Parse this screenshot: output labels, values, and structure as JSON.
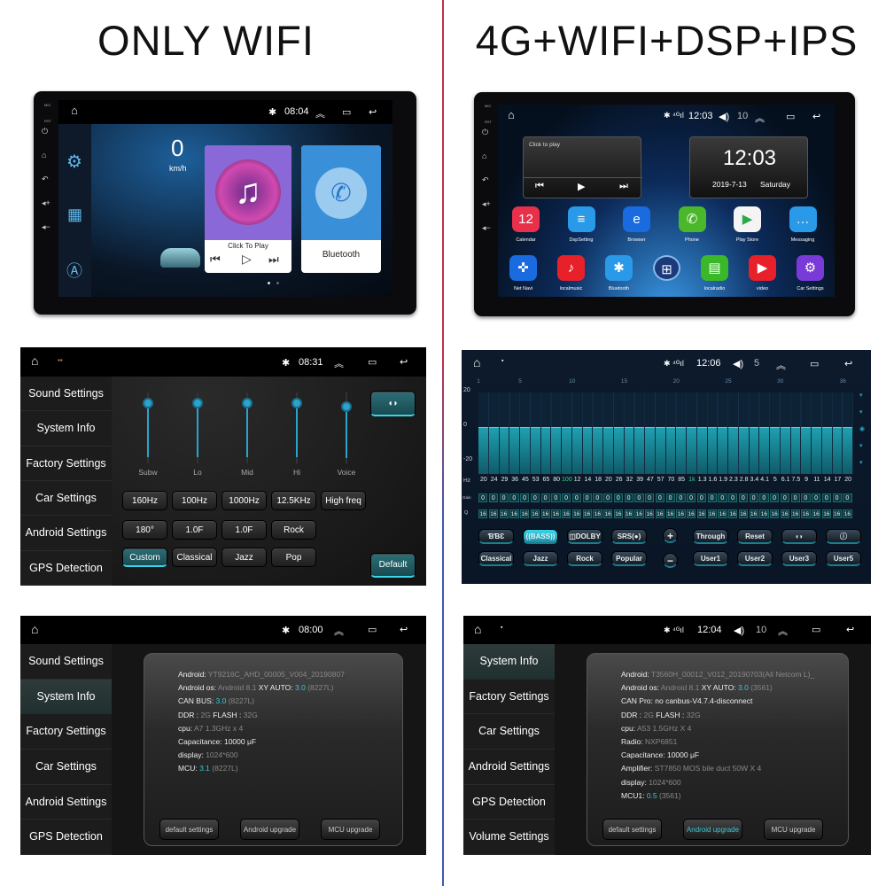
{
  "titles": {
    "left": "ONLY WIFI",
    "right": "4G+WIFI+DSP+IPS"
  },
  "colors": {
    "accent": "#36c9d8",
    "divider_top": "#c0304a",
    "divider_bottom": "#3a5bb0"
  },
  "device_side_labels": {
    "mic": "MIC",
    "rst": "RST"
  },
  "home_wifi": {
    "time": "08:04",
    "speed": "0",
    "speed_unit": "km/h",
    "music_label": "Click To Play",
    "bluetooth_label": "Bluetooth"
  },
  "home_4g": {
    "time": "12:03",
    "volume": "10",
    "player_label": "Click to play",
    "clock": "12:03",
    "date": "2019-7-13",
    "weekday": "Saturday",
    "apps_row1": [
      "Calendar",
      "DspSetting",
      "Browser",
      "Phone",
      "Play Store",
      "Messaging"
    ],
    "apps_row2": [
      "Net Navi",
      "localmusic",
      "Bluetooth",
      "",
      "localradio",
      "video",
      "Car Settings"
    ],
    "calendar_day": "12"
  },
  "sound_wifi": {
    "time": "08:31",
    "menu": [
      "Sound Settings",
      "System Info",
      "Factory Settings",
      "Car Settings",
      "Android Settings",
      "GPS Detection"
    ],
    "sliders": [
      {
        "label": "Subw",
        "level": 0.85
      },
      {
        "label": "Lo",
        "level": 0.85
      },
      {
        "label": "Mid",
        "level": 0.85
      },
      {
        "label": "Hi",
        "level": 0.85
      },
      {
        "label": "Voice",
        "level": 0.8
      }
    ],
    "freq_buttons": [
      "160Hz",
      "100Hz",
      "1000Hz",
      "12.5KHz",
      "High freq"
    ],
    "row2_buttons": [
      "180°",
      "1.0F",
      "1.0F",
      "Rock"
    ],
    "preset_buttons": [
      "Custom",
      "Classical",
      "Jazz",
      "Pop"
    ],
    "selected_preset": "Custom",
    "default_label": "Default"
  },
  "dsp_4g": {
    "time": "12:06",
    "volume": "5",
    "band_numbers": [
      "1",
      "5",
      "10",
      "15",
      "20",
      "25",
      "30",
      "36"
    ],
    "y_ticks": [
      "20",
      "0",
      "-20"
    ],
    "hz_label": "Hz",
    "gain_label": "Gain",
    "q_label": "Q",
    "frequencies": [
      "20",
      "24",
      "29",
      "36",
      "45",
      "53",
      "65",
      "80",
      "100",
      "12",
      "14",
      "18",
      "20",
      "26",
      "32",
      "39",
      "47",
      "57",
      "70",
      "85",
      "1k",
      "1.3",
      "1.6",
      "1.9",
      "2.3",
      "2.8",
      "3.4",
      "4.1",
      "5",
      "6.1",
      "7.5",
      "9",
      "11",
      "14",
      "17",
      "20"
    ],
    "highlighted_frequencies": [
      "100",
      "1k"
    ],
    "gains": [
      0,
      0,
      0,
      0,
      0,
      0,
      0,
      0,
      0,
      0,
      0,
      0,
      0,
      0,
      0,
      0,
      0,
      0,
      0,
      0,
      0,
      0,
      0,
      0,
      0,
      0,
      0,
      0,
      0,
      0,
      0,
      0,
      0,
      0,
      0,
      0
    ],
    "q_values": [
      16,
      16,
      16,
      16,
      16,
      16,
      16,
      16,
      16,
      16,
      16,
      16,
      16,
      16,
      16,
      16,
      16,
      16,
      16,
      16,
      16,
      16,
      16,
      16,
      16,
      16,
      16,
      16,
      16,
      16,
      16,
      16,
      16,
      16,
      16,
      16
    ],
    "effect_buttons": [
      "ƁƁƐ",
      "((BASS))",
      "◫DOLBY",
      "SRS(●)"
    ],
    "active_effect": "((BASS))",
    "preset_buttons": [
      "Classical",
      "Jazz",
      "Rock",
      "Popular"
    ],
    "plus": "+",
    "minus": "−",
    "right_row1": [
      "Through",
      "Reset",
      "◖◗",
      "ⓘ"
    ],
    "user_buttons": [
      "User1",
      "User2",
      "User3",
      "User5"
    ]
  },
  "info_wifi": {
    "time": "08:00",
    "menu": [
      "Sound Settings",
      "System Info",
      "Factory Settings",
      "Car Settings",
      "Android Settings",
      "GPS Detection"
    ],
    "selected": "System Info",
    "lines": [
      [
        {
          "t": "Android:  ",
          "s": "k"
        },
        {
          "t": "YT9216C_AHD_00005_V004_20190807",
          "s": "g"
        }
      ],
      [
        {
          "t": "Android os:  ",
          "s": "k"
        },
        {
          "t": "Android 8.1   ",
          "s": "g"
        },
        {
          "t": "XY AUTO:  ",
          "s": "k"
        },
        {
          "t": "3.0",
          "s": "c"
        },
        {
          "t": "  (8227L)",
          "s": "g"
        }
      ],
      [
        {
          "t": "CAN BUS:  ",
          "s": "k"
        },
        {
          "t": "3.0",
          "s": "c"
        },
        {
          "t": "  (8227L)",
          "s": "g"
        }
      ],
      [
        {
          "t": "DDR :  ",
          "s": "k"
        },
        {
          "t": "2G      ",
          "s": "g"
        },
        {
          "t": "FLASH :  ",
          "s": "k"
        },
        {
          "t": "32G",
          "s": "g"
        }
      ],
      [
        {
          "t": "cpu:  ",
          "s": "k"
        },
        {
          "t": "A7 1.3GHz x 4",
          "s": "g"
        }
      ],
      [
        {
          "t": "Capacitance:  10000 μF",
          "s": "k"
        }
      ],
      [
        {
          "t": "display:  ",
          "s": "k"
        },
        {
          "t": "1024*600",
          "s": "g"
        }
      ],
      [
        {
          "t": "MCU:  ",
          "s": "k"
        },
        {
          "t": "3.1",
          "s": "c"
        },
        {
          "t": "  (8227L)",
          "s": "g"
        }
      ]
    ],
    "buttons": [
      "default settings",
      "Android upgrade",
      "MCU upgrade"
    ]
  },
  "info_4g": {
    "time": "12:04",
    "volume": "10",
    "menu": [
      "System Info",
      "Factory Settings",
      "Car Settings",
      "Android Settings",
      "GPS Detection",
      "Volume Settings"
    ],
    "selected": "System Info",
    "lines": [
      [
        {
          "t": "Android:  ",
          "s": "k"
        },
        {
          "t": "T3560H_00012_V012_20190703(All Netcom L)_",
          "s": "g"
        }
      ],
      [
        {
          "t": "Android os:  ",
          "s": "k"
        },
        {
          "t": "Android 8.1   ",
          "s": "g"
        },
        {
          "t": "XY AUTO:  ",
          "s": "k"
        },
        {
          "t": "3.0",
          "s": "c"
        },
        {
          "t": "  (3561)",
          "s": "g"
        }
      ],
      [
        {
          "t": "CAN Pro:  no canbus-V4.7.4-disconnect",
          "s": "k"
        }
      ],
      [
        {
          "t": "DDR :  ",
          "s": "k"
        },
        {
          "t": "2G      ",
          "s": "g"
        },
        {
          "t": "FLASH :  ",
          "s": "k"
        },
        {
          "t": "32G",
          "s": "g"
        }
      ],
      [
        {
          "t": "cpu:  ",
          "s": "k"
        },
        {
          "t": "A53 1.5GHz X 4",
          "s": "g"
        }
      ],
      [
        {
          "t": "Radio:  ",
          "s": "k"
        },
        {
          "t": "NXP6851",
          "s": "g"
        }
      ],
      [
        {
          "t": "Capacitance:  10000 μF",
          "s": "k"
        }
      ],
      [
        {
          "t": "Amplifier:  ",
          "s": "k"
        },
        {
          "t": "ST7850 MOS bile duct 50W X 4",
          "s": "g"
        }
      ],
      [
        {
          "t": "display:  ",
          "s": "k"
        },
        {
          "t": "1024*600",
          "s": "g"
        }
      ],
      [
        {
          "t": "MCU1:  ",
          "s": "k"
        },
        {
          "t": "0.5",
          "s": "c"
        },
        {
          "t": "  (3561)",
          "s": "g"
        }
      ]
    ],
    "buttons": [
      "default settings",
      "Android upgrade",
      "MCU upgrade"
    ],
    "active_button": "Android upgrade"
  }
}
